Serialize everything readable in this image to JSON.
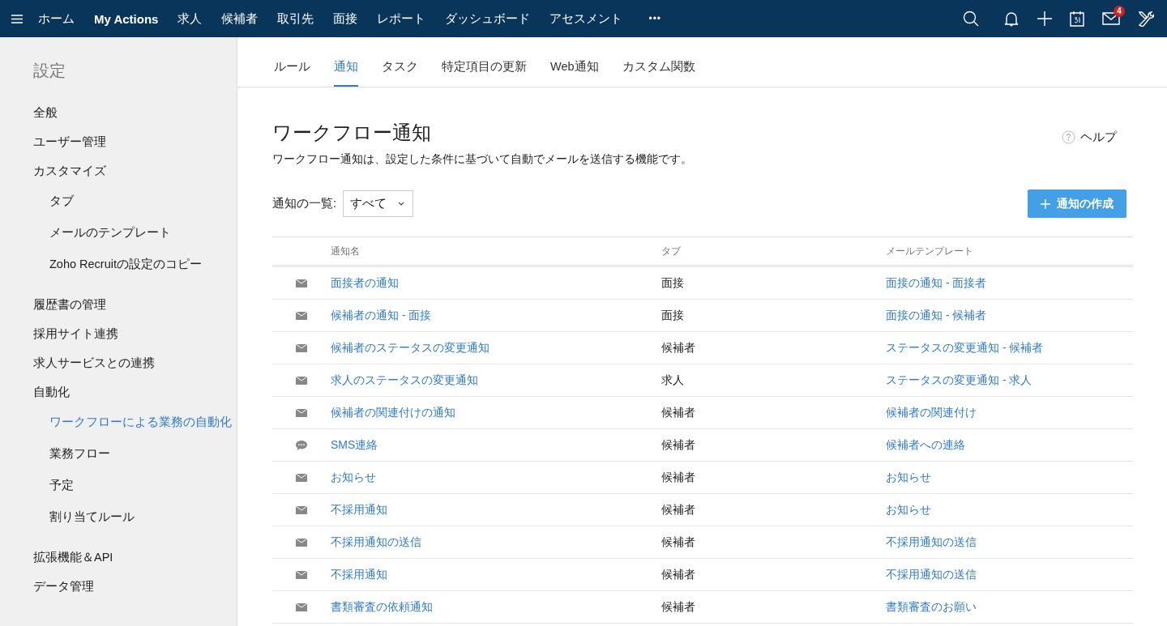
{
  "topbar": {
    "menu_items": [
      {
        "label": "ホーム",
        "selected": false
      },
      {
        "label": "My Actions",
        "selected": true
      },
      {
        "label": "求人",
        "selected": false
      },
      {
        "label": "候補者",
        "selected": false
      },
      {
        "label": "取引先",
        "selected": false
      },
      {
        "label": "面接",
        "selected": false
      },
      {
        "label": "レポート",
        "selected": false
      },
      {
        "label": "ダッシュボード",
        "selected": false
      },
      {
        "label": "アセスメント",
        "selected": false
      }
    ],
    "more": "•••",
    "mail_badge": "4"
  },
  "sidebar": {
    "title": "設定",
    "items": [
      {
        "label": "全般",
        "selected": false
      },
      {
        "label": "ユーザー管理",
        "selected": false
      },
      {
        "label": "カスタマイズ",
        "selected": false,
        "children": [
          {
            "label": "タブ",
            "selected": false
          },
          {
            "label": "メールのテンプレート",
            "selected": false
          },
          {
            "label": "Zoho Recruitの設定のコピー",
            "selected": false
          }
        ]
      },
      {
        "label": "履歴書の管理",
        "selected": false
      },
      {
        "label": "採用サイト連携",
        "selected": false
      },
      {
        "label": "求人サービスとの連携",
        "selected": false
      },
      {
        "label": "自動化",
        "selected": false,
        "children": [
          {
            "label": "ワークフローによる業務の自動化",
            "selected": true
          },
          {
            "label": "業務フロー",
            "selected": false
          },
          {
            "label": "予定",
            "selected": false
          },
          {
            "label": "割り当てルール",
            "selected": false
          }
        ]
      },
      {
        "label": "拡張機能＆API",
        "selected": false
      },
      {
        "label": "データ管理",
        "selected": false
      }
    ]
  },
  "tabs": [
    {
      "label": "ルール",
      "selected": false
    },
    {
      "label": "通知",
      "selected": true
    },
    {
      "label": "タスク",
      "selected": false
    },
    {
      "label": "特定項目の更新",
      "selected": false
    },
    {
      "label": "Web通知",
      "selected": false
    },
    {
      "label": "カスタム関数",
      "selected": false
    }
  ],
  "page": {
    "title": "ワークフロー通知",
    "help": "ヘルプ",
    "description": "ワークフロー通知は、設定した条件に基づいて自動でメールを送信する機能です。",
    "filter_label": "通知の一覧:",
    "filter_value": "すべて",
    "create_button": "通知の作成"
  },
  "table": {
    "columns": [
      "通知名",
      "タブ",
      "メールテンプレート"
    ],
    "rows": [
      {
        "kind": "mail",
        "name": "面接者の通知",
        "tab": "面接",
        "template": "面接の通知 - 面接者"
      },
      {
        "kind": "mail",
        "name": "候補者の通知 - 面接",
        "tab": "面接",
        "template": "面接の通知 - 候補者"
      },
      {
        "kind": "mail",
        "name": "候補者のステータスの変更通知",
        "tab": "候補者",
        "template": "ステータスの変更通知 - 候補者"
      },
      {
        "kind": "mail",
        "name": "求人のステータスの変更通知",
        "tab": "求人",
        "template": "ステータスの変更通知 - 求人"
      },
      {
        "kind": "mail",
        "name": "候補者の関連付けの通知",
        "tab": "候補者",
        "template": "候補者の関連付け"
      },
      {
        "kind": "sms",
        "name": "SMS連絡",
        "tab": "候補者",
        "template": "候補者への連絡"
      },
      {
        "kind": "mail",
        "name": "お知らせ",
        "tab": "候補者",
        "template": "お知らせ"
      },
      {
        "kind": "mail",
        "name": "不採用通知",
        "tab": "候補者",
        "template": "お知らせ"
      },
      {
        "kind": "mail",
        "name": "不採用通知の送信",
        "tab": "候補者",
        "template": "不採用通知の送信"
      },
      {
        "kind": "mail",
        "name": "不採用通知",
        "tab": "候補者",
        "template": "不採用通知の送信"
      },
      {
        "kind": "mail",
        "name": "書類審査の依頼通知",
        "tab": "候補者",
        "template": "書類審査のお願い"
      }
    ]
  }
}
